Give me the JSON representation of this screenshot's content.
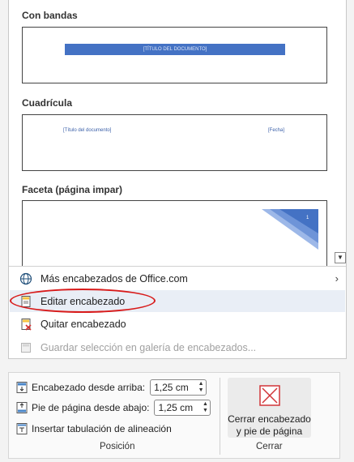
{
  "gallery": {
    "sections": [
      {
        "title": "Con bandas",
        "placeholder": "[TÍTULO DEL DOCUMENTO]"
      },
      {
        "title": "Cuadrícula",
        "left_placeholder": "[Título del documento]",
        "right_placeholder": "[Fecha]"
      },
      {
        "title": "Faceta (página impar)",
        "page_number": "1"
      }
    ],
    "accent_color": "#4472c4"
  },
  "menu": {
    "items": [
      {
        "label": "Más encabezados de Office.com",
        "icon": "globe-icon",
        "has_submenu": true
      },
      {
        "label": "Editar encabezado",
        "icon": "edit-header-icon",
        "highlighted": true
      },
      {
        "label": "Quitar encabezado",
        "icon": "remove-header-icon"
      },
      {
        "label": "Guardar selección en galería de encabezados...",
        "icon": "save-selection-icon",
        "disabled": true
      }
    ]
  },
  "ribbon": {
    "position_group": {
      "header_from_top_label": "Encabezado desde arriba:",
      "header_from_top_value": "1,25 cm",
      "footer_from_bottom_label": "Pie de página desde abajo:",
      "footer_from_bottom_value": "1,25 cm",
      "insert_tab_label": "Insertar tabulación de alineación",
      "group_label": "Posición"
    },
    "close_group": {
      "button_line1": "Cerrar encabezado",
      "button_line2": "y pie de página",
      "group_label": "Cerrar"
    }
  }
}
